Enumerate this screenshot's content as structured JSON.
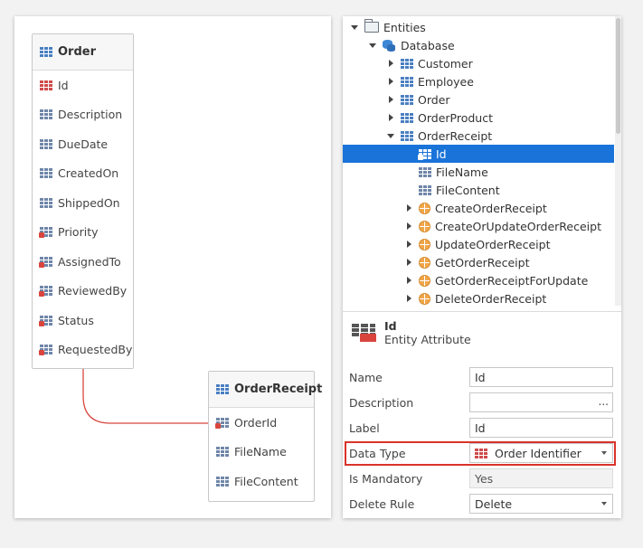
{
  "diagram": {
    "order_entity": {
      "name": "Order",
      "attributes": [
        {
          "name": "Id",
          "kind": "primary-key"
        },
        {
          "name": "Description",
          "kind": "attribute"
        },
        {
          "name": "DueDate",
          "kind": "attribute"
        },
        {
          "name": "CreatedOn",
          "kind": "attribute"
        },
        {
          "name": "ShippedOn",
          "kind": "attribute"
        },
        {
          "name": "Priority",
          "kind": "foreign-key"
        },
        {
          "name": "AssignedTo",
          "kind": "foreign-key"
        },
        {
          "name": "ReviewedBy",
          "kind": "foreign-key"
        },
        {
          "name": "Status",
          "kind": "foreign-key"
        },
        {
          "name": "RequestedBy",
          "kind": "foreign-key"
        }
      ]
    },
    "receipt_entity": {
      "name": "OrderReceipt",
      "attributes": [
        {
          "name": "OrderId",
          "kind": "foreign-key"
        },
        {
          "name": "FileName",
          "kind": "attribute"
        },
        {
          "name": "FileContent",
          "kind": "attribute"
        }
      ]
    },
    "relationship_color": "#d9453d"
  },
  "tree": {
    "items": [
      {
        "label": "Entities",
        "level": 0,
        "arrow": "down",
        "icon": "folder-icon"
      },
      {
        "label": "Database",
        "level": 1,
        "arrow": "down",
        "icon": "database-icon"
      },
      {
        "label": "Customer",
        "level": 2,
        "arrow": "right",
        "icon": "entity-icon"
      },
      {
        "label": "Employee",
        "level": 2,
        "arrow": "right",
        "icon": "entity-icon"
      },
      {
        "label": "Order",
        "level": 2,
        "arrow": "right",
        "icon": "entity-icon"
      },
      {
        "label": "OrderProduct",
        "level": 2,
        "arrow": "right",
        "icon": "entity-icon"
      },
      {
        "label": "OrderReceipt",
        "level": 2,
        "arrow": "down",
        "icon": "entity-icon"
      },
      {
        "label": "Id",
        "level": 3,
        "arrow": "none",
        "icon": "foreign-key-attribute-icon",
        "selected": true
      },
      {
        "label": "FileName",
        "level": 3,
        "arrow": "none",
        "icon": "attribute-icon"
      },
      {
        "label": "FileContent",
        "level": 3,
        "arrow": "none",
        "icon": "attribute-icon"
      },
      {
        "label": "CreateOrderReceipt",
        "level": 3,
        "arrow": "right",
        "icon": "entity-action-icon"
      },
      {
        "label": "CreateOrUpdateOrderReceipt",
        "level": 3,
        "arrow": "right",
        "icon": "entity-action-icon"
      },
      {
        "label": "UpdateOrderReceipt",
        "level": 3,
        "arrow": "right",
        "icon": "entity-action-icon"
      },
      {
        "label": "GetOrderReceipt",
        "level": 3,
        "arrow": "right",
        "icon": "entity-action-icon"
      },
      {
        "label": "GetOrderReceiptForUpdate",
        "level": 3,
        "arrow": "right",
        "icon": "entity-action-icon"
      },
      {
        "label": "DeleteOrderReceipt",
        "level": 3,
        "arrow": "right",
        "icon": "entity-action-icon"
      }
    ],
    "selected_color": "#1a73d9"
  },
  "properties": {
    "title": "Id",
    "subtitle": "Entity Attribute",
    "name_label": "Name",
    "name_value": "Id",
    "description_label": "Description",
    "description_value": "",
    "description_button": "...",
    "label_label": "Label",
    "label_value": "Id",
    "data_type_label": "Data Type",
    "data_type_value": "Order Identifier",
    "is_mandatory_label": "Is Mandatory",
    "is_mandatory_value": "Yes",
    "delete_rule_label": "Delete Rule",
    "delete_rule_value": "Delete",
    "highlight_color": "#d9332b"
  }
}
